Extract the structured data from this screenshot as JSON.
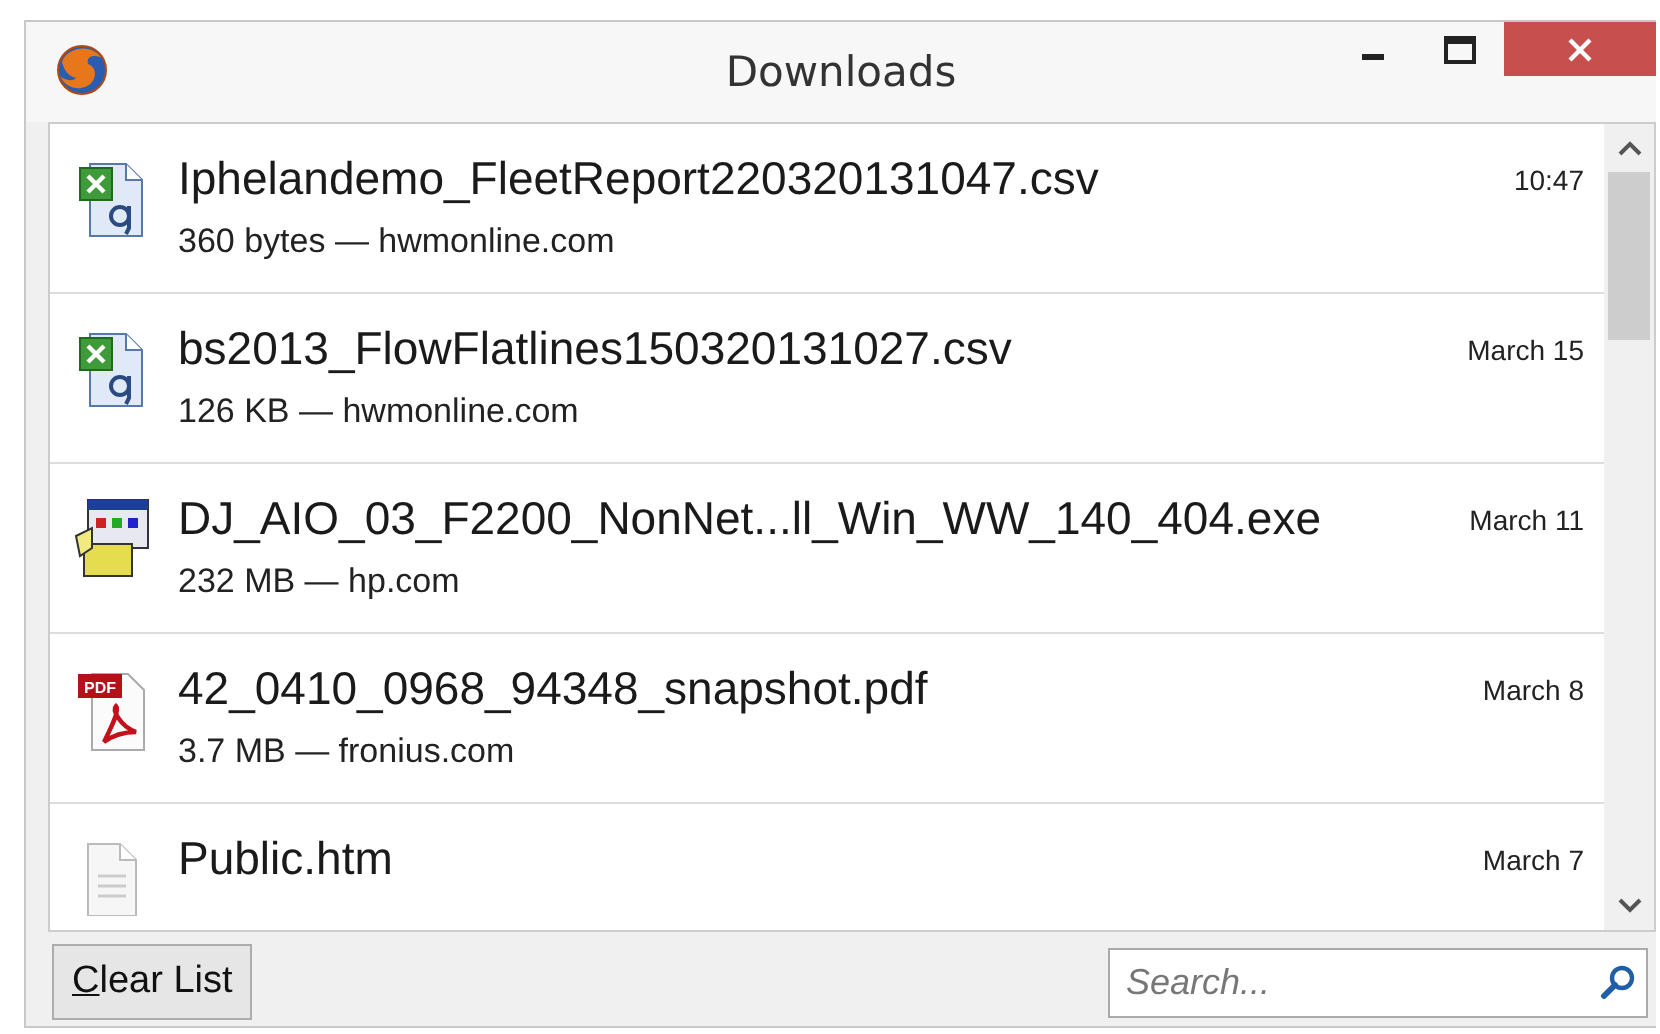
{
  "window": {
    "title": "Downloads"
  },
  "downloads": [
    {
      "kind": "spreadsheet",
      "name": "Iphelandemo_FleetReport220320131047.csv",
      "details": "360 bytes — hwmonline.com",
      "time": "10:47"
    },
    {
      "kind": "spreadsheet",
      "name": "bs2013_FlowFlatlines150320131027.csv",
      "details": "126 KB — hwmonline.com",
      "time": "March 15"
    },
    {
      "kind": "installer",
      "name": "DJ_AIO_03_F2200_NonNet...ll_Win_WW_140_404.exe",
      "details": "232 MB — hp.com",
      "time": "March 11"
    },
    {
      "kind": "pdf",
      "icon_label": "PDF",
      "name": "42_0410_0968_94348_snapshot.pdf",
      "details": "3.7 MB — fronius.com",
      "time": "March 8"
    },
    {
      "kind": "document",
      "name": "Public.htm",
      "time": "March 7"
    }
  ],
  "clear_button": {
    "label": "Clear List"
  },
  "search": {
    "placeholder": "Search..."
  }
}
